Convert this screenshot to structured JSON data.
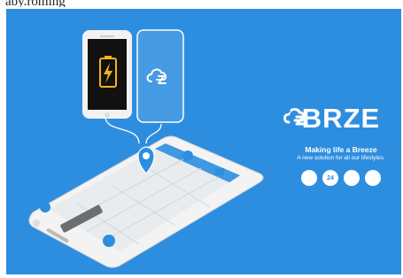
{
  "top_fragment": "aby.roming",
  "brand": {
    "logo_left": "BR",
    "logo_right": "ZE",
    "tagline": "Making life a Breeze",
    "subline": "A new solution for all our lifestyles.",
    "badges": [
      {
        "icon": "no-charge-icon"
      },
      {
        "icon": "24h-icon",
        "label": "24"
      },
      {
        "icon": "android-icon"
      },
      {
        "icon": "apple-icon"
      }
    ]
  },
  "colors": {
    "background": "#2d8ee0",
    "battery": "#f5b21b",
    "map": "#e8ecee"
  }
}
